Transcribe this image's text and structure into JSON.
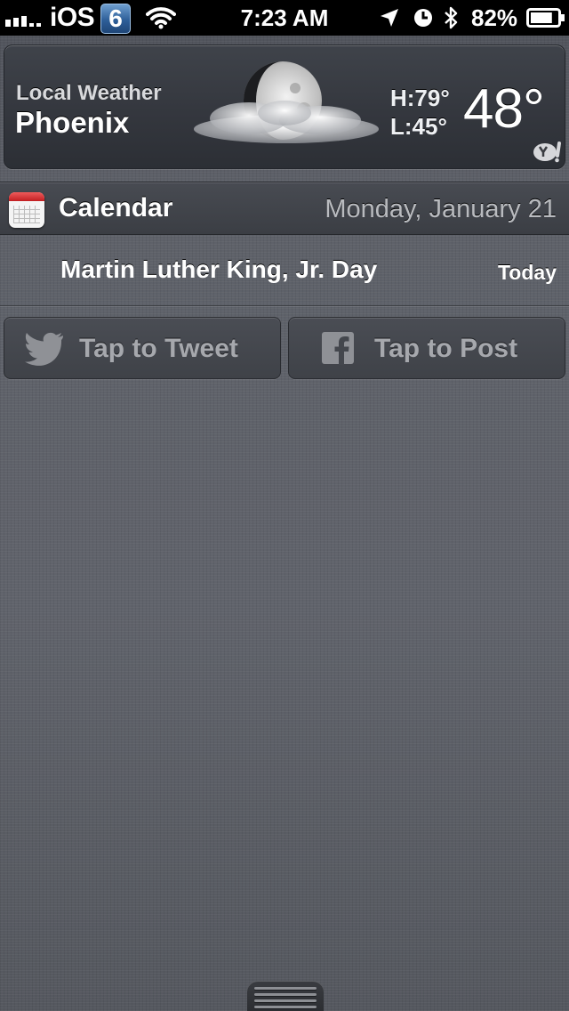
{
  "status_bar": {
    "carrier": "iOS",
    "carrier_badge": "6",
    "time": "7:23 AM",
    "battery_percent": "82%",
    "icons": [
      "signal-icon",
      "wifi-icon",
      "location-arrow-icon",
      "alarm-clock-icon",
      "bluetooth-icon",
      "battery-icon"
    ],
    "battery_level": 0.82
  },
  "weather": {
    "label": "Local Weather",
    "city": "Phoenix",
    "high": "H:79°",
    "low": "L:45°",
    "temperature": "48°",
    "condition_icon": "moon-cloud-icon",
    "provider_icon": "yahoo-icon"
  },
  "calendar": {
    "title": "Calendar",
    "date": "Monday, January 21",
    "events": [
      {
        "title": "Martin Luther King, Jr. Day",
        "when": "Today"
      }
    ]
  },
  "share": {
    "tweet_label": "Tap to Tweet",
    "post_label": "Tap to Post"
  },
  "colors": {
    "background": "#5d6068",
    "status_bar": "#000000",
    "calendar_accent": "#c21f22"
  }
}
